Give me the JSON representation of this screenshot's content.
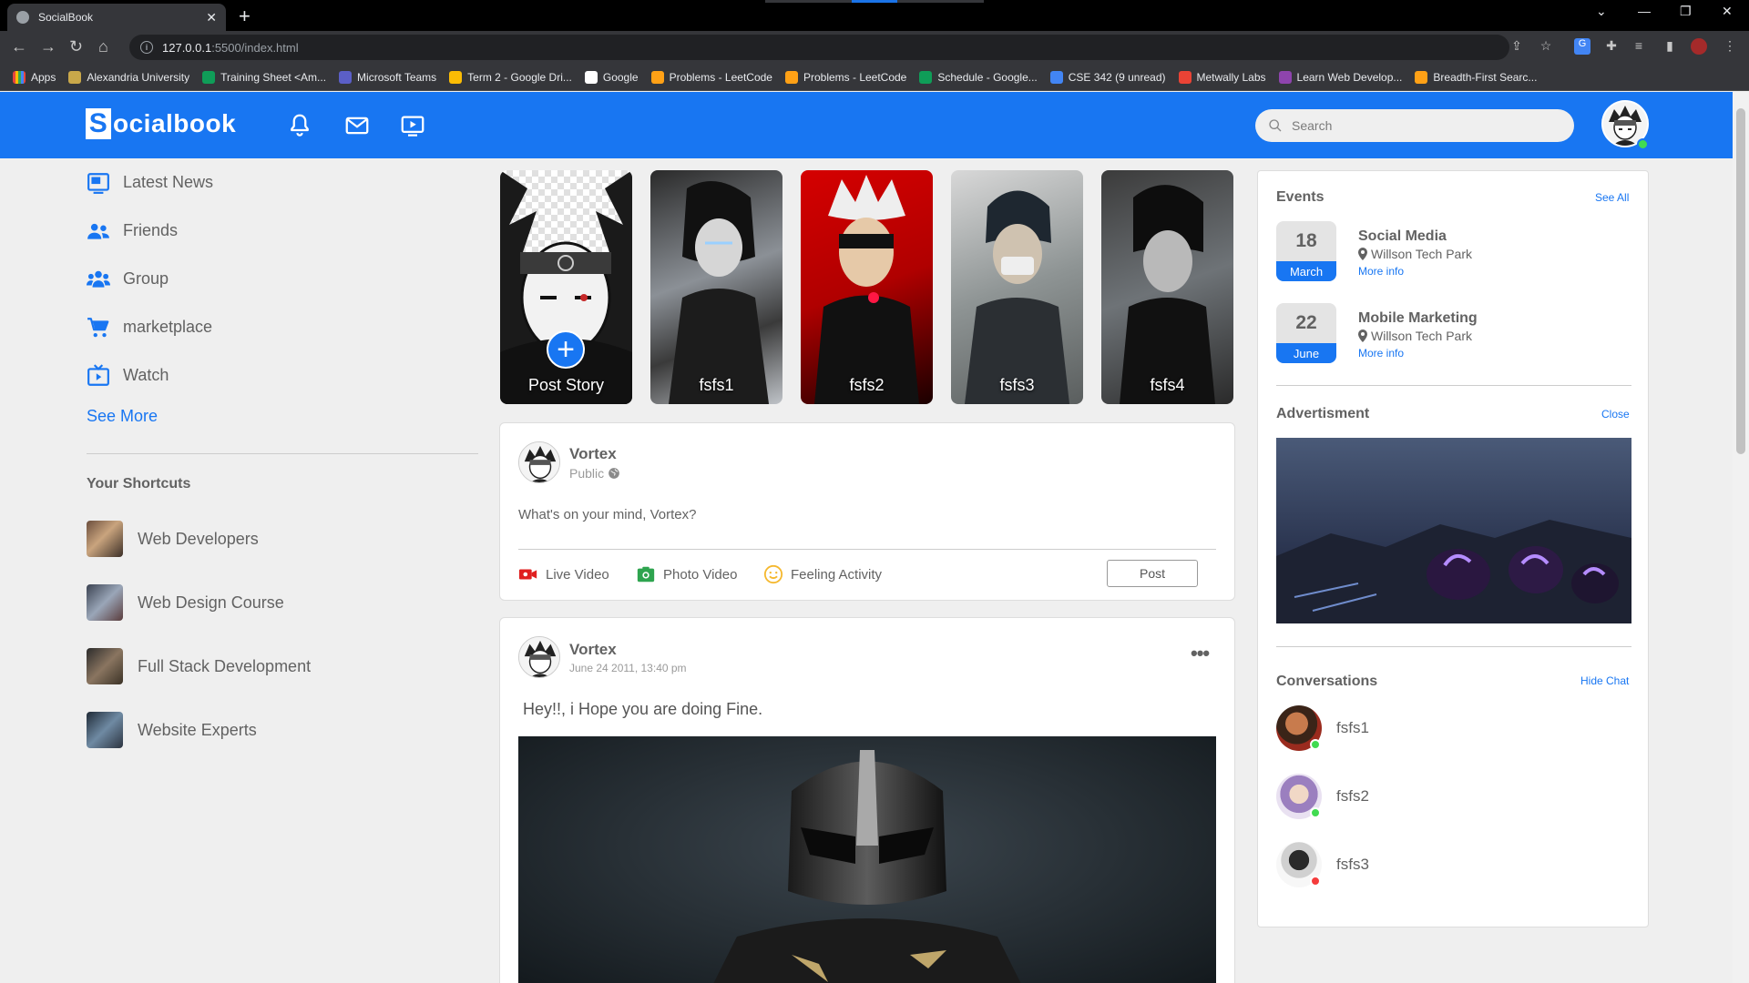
{
  "browser": {
    "tab_title": "SocialBook",
    "url_host": "127.0.0.1",
    "url_path": ":5500/index.html",
    "bookmarks": [
      {
        "label": "Apps",
        "color": "#e8453c"
      },
      {
        "label": "Alexandria University",
        "color": "#c9a84a"
      },
      {
        "label": "Training Sheet <Am...",
        "color": "#0f9d58"
      },
      {
        "label": "Microsoft Teams",
        "color": "#5b5fc7"
      },
      {
        "label": "Term 2 - Google Dri...",
        "color": "#fbbc04"
      },
      {
        "label": "Google",
        "color": "#ffffff"
      },
      {
        "label": "Problems - LeetCode",
        "color": "#ffa116"
      },
      {
        "label": "Problems - LeetCode",
        "color": "#ffa116"
      },
      {
        "label": "Schedule - Google...",
        "color": "#0f9d58"
      },
      {
        "label": "CSE 342 (9 unread)",
        "color": "#4285f4"
      },
      {
        "label": "Metwally Labs",
        "color": "#ea4335"
      },
      {
        "label": "Learn Web Develop...",
        "color": "#8e44ad"
      },
      {
        "label": "Breadth-First Searc...",
        "color": "#ffa116"
      }
    ]
  },
  "nav": {
    "logo_letter": "S",
    "logo_rest": "ocialbook",
    "search_placeholder": "Search",
    "brand_color": "#1876f2"
  },
  "left_sidebar": {
    "items": [
      {
        "label": "Latest News",
        "icon": "news-icon"
      },
      {
        "label": "Friends",
        "icon": "friends-icon"
      },
      {
        "label": "Group",
        "icon": "group-icon"
      },
      {
        "label": "marketplace",
        "icon": "cart-icon"
      },
      {
        "label": "Watch",
        "icon": "watch-icon"
      }
    ],
    "see_more": "See More",
    "shortcuts_title": "Your Shortcuts",
    "shortcuts": [
      {
        "label": "Web Developers"
      },
      {
        "label": "Web Design Course"
      },
      {
        "label": "Full Stack Development"
      },
      {
        "label": "Website Experts"
      }
    ]
  },
  "stories": [
    {
      "label": "Post Story"
    },
    {
      "label": "fsfs1"
    },
    {
      "label": "fsfs2"
    },
    {
      "label": "fsfs3"
    },
    {
      "label": "fsfs4"
    }
  ],
  "compose": {
    "user_name": "Vortex",
    "privacy": "Public",
    "placeholder": "What's on your mind, Vortex?",
    "actions": [
      {
        "label": "Live Video",
        "icon": "live-video-icon"
      },
      {
        "label": "Photo Video",
        "icon": "photo-icon"
      },
      {
        "label": "Feeling Activity",
        "icon": "smiley-icon"
      }
    ],
    "post_label": "Post"
  },
  "post": {
    "user_name": "Vortex",
    "timestamp": "June 24 2011, 13:40 pm",
    "text": "Hey!!, i Hope you are doing Fine."
  },
  "right_sidebar": {
    "events_title": "Events",
    "see_all": "See All",
    "events": [
      {
        "day": "18",
        "month": "March",
        "title": "Social Media",
        "location": "Willson Tech Park",
        "more": "More info"
      },
      {
        "day": "22",
        "month": "June",
        "title": "Mobile Marketing",
        "location": "Willson Tech Park",
        "more": "More info"
      }
    ],
    "ad_title": "Advertisment",
    "ad_close": "Close",
    "conv_title": "Conversations",
    "hide_chat": "Hide Chat",
    "conversations": [
      {
        "name": "fsfs1",
        "status_color": "#41db51"
      },
      {
        "name": "fsfs2",
        "status_color": "#41db51"
      },
      {
        "name": "fsfs3",
        "status_color": "#f53c3c"
      }
    ]
  }
}
